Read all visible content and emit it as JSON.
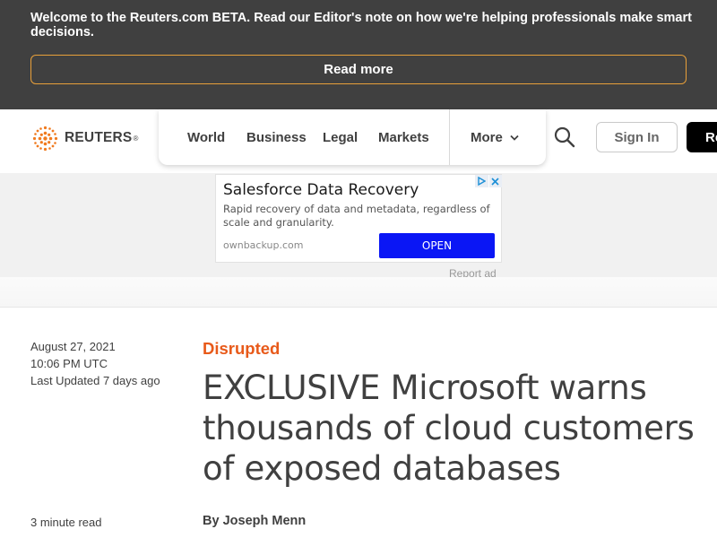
{
  "banner": {
    "message": "Welcome to the Reuters.com BETA. Read our Editor's note on how we're helping professionals make smart decisions.",
    "read_more": "Read more"
  },
  "header": {
    "logo_text": "REUTERS",
    "logo_mark": "®",
    "nav": [
      "World",
      "Business",
      "Legal",
      "Markets",
      "More"
    ],
    "sign_in": "Sign In",
    "register": "Register",
    "icons": [
      "reuters-logo-icon",
      "chevron-down-icon",
      "search-icon"
    ]
  },
  "ad": {
    "title": "Salesforce Data Recovery",
    "description": "Rapid recovery of data and metadata, regardless of scale and granularity.",
    "domain": "ownbackup.com",
    "cta": "OPEN",
    "report": "Report ad",
    "cta_color": "#0a16f5"
  },
  "article": {
    "date": "August 27, 2021",
    "time": "10:06 PM UTC",
    "updated": "Last Updated 7 days ago",
    "kicker": "Disrupted",
    "headline": "EXCLUSIVE Microsoft warns thousands of cloud customers of exposed databases",
    "read_time": "3 minute read",
    "byline_prefix": "By",
    "author": "Joseph Menn",
    "kicker_color": "#e85a1a"
  }
}
